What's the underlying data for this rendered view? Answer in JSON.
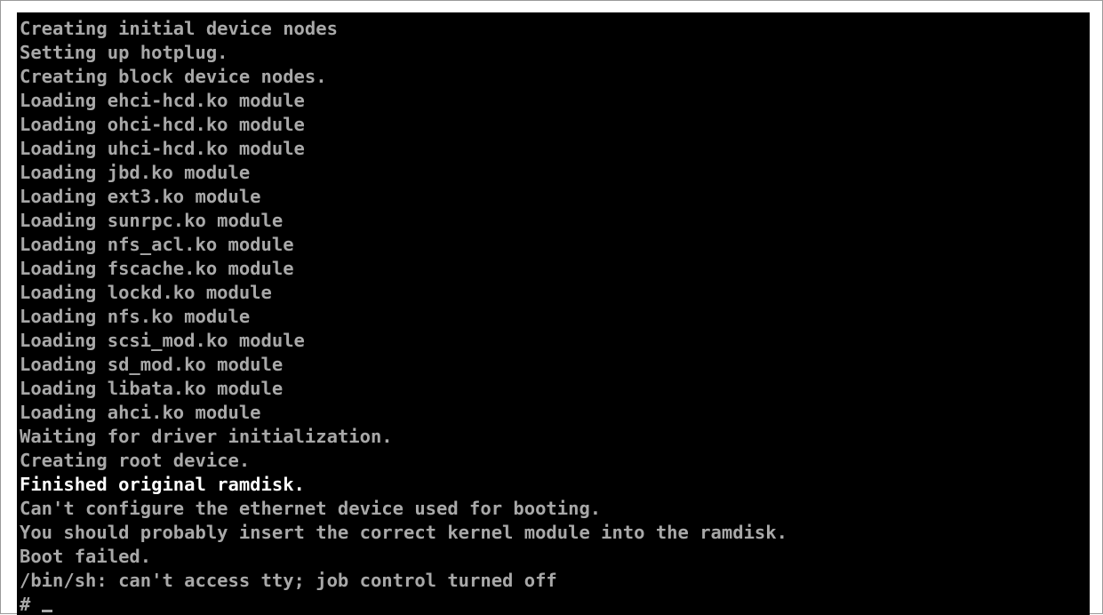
{
  "colors": {
    "background": "#000000",
    "text": "#a8a8a8",
    "highlight": "#ffffff",
    "frame_border": "#9a9a9a"
  },
  "console": {
    "lines": [
      "Creating initial device nodes",
      "Setting up hotplug.",
      "Creating block device nodes.",
      "Loading ehci-hcd.ko module",
      "Loading ohci-hcd.ko module",
      "Loading uhci-hcd.ko module",
      "Loading jbd.ko module",
      "Loading ext3.ko module",
      "Loading sunrpc.ko module",
      "Loading nfs_acl.ko module",
      "Loading fscache.ko module",
      "Loading lockd.ko module",
      "Loading nfs.ko module",
      "Loading scsi_mod.ko module",
      "Loading sd_mod.ko module",
      "Loading libata.ko module",
      "Loading ahci.ko module",
      "Waiting for driver initialization.",
      "Creating root device.",
      "Finished original ramdisk.",
      "Can't configure the ethernet device used for booting.",
      "You should probably insert the correct kernel module into the ramdisk.",
      "Boot failed.",
      "/bin/sh: can't access tty; job control turned off"
    ],
    "prompt": "#",
    "cursor_icon": "block-underscore-cursor"
  }
}
